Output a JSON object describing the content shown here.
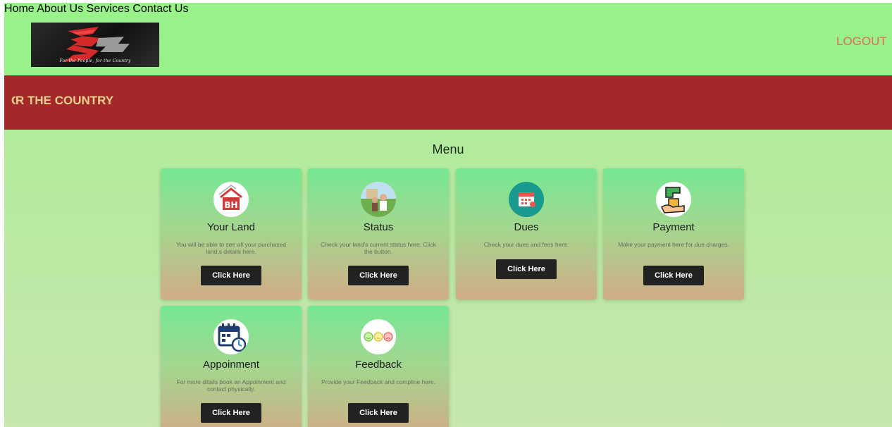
{
  "header": {
    "logo_tagline": "For the People, for the Country",
    "nav": [
      "Home",
      "About Us",
      "Services",
      "Contact Us"
    ],
    "logout_label": "LOGOUT"
  },
  "banner": {
    "text": "R THE COUNTRY"
  },
  "menu": {
    "title": "Menu",
    "cards": [
      {
        "title": "Your Land",
        "description": "You will be able to see all your purchased land,s details here.",
        "button": "Click Here",
        "icon": "house-icon"
      },
      {
        "title": "Status",
        "description": "Check your land's current status here. Click the button.",
        "button": "Click Here",
        "icon": "land-photo-icon"
      },
      {
        "title": "Dues",
        "description": "Check your dues and fees here.",
        "button": "Click Here",
        "icon": "calendar-icon"
      },
      {
        "title": "Payment",
        "description": "Make your payment here for due charges.",
        "button": "Click Here",
        "icon": "hand-payment-icon"
      },
      {
        "title": "Appoinment",
        "description": "For more ditails book an Appoinment and contact physically.",
        "button": "Click Here",
        "icon": "appointment-calendar-icon"
      },
      {
        "title": "Feedback",
        "description": "Provide your Feedback and compline here.",
        "button": "Click Here",
        "icon": "feedback-faces-icon"
      }
    ]
  },
  "colors": {
    "header_bg": "#98f189",
    "banner_bg": "#a2282a",
    "banner_text": "#f1d08f",
    "logout": "#e06a5d",
    "button_bg": "#222222"
  }
}
